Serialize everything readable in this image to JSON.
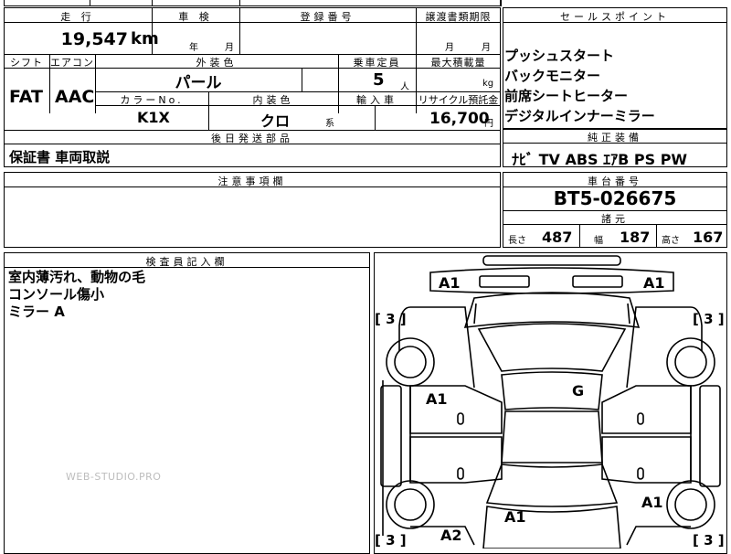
{
  "top_strip": "",
  "labels": {
    "mileage": "走 行",
    "inspection": "車 検",
    "registration": "登録番号",
    "transfer_deadline": "譲渡書類期限",
    "shift": "シフト",
    "aircon": "エアコン",
    "exterior_color": "外装色",
    "capacity": "乗車定員",
    "max_load": "最大積載量",
    "color_no": "カラーNo.",
    "interior_color": "内装色",
    "import": "輸入車",
    "recycle": "リサイクル預託金",
    "later_items": "後日発送部品",
    "notes": "注意事項欄",
    "sales_points": "セールスポイント",
    "equipment": "純正装備",
    "chassis": "車台番号",
    "dimensions": "諸元",
    "inspector": "検査員記入欄"
  },
  "units": {
    "km": "km",
    "year": "年",
    "month": "月",
    "persons": "人",
    "kg": "kg",
    "kei": "系",
    "yen": "円"
  },
  "vehicle": {
    "mileage": "19,547",
    "shift": "FAT",
    "aircon": "AAC",
    "exterior_color": "パール",
    "capacity": "5",
    "color_no": "K1X",
    "interior_color": "クロ",
    "recycle_fee": "16,700"
  },
  "later_items_value": "保証書 車両取説",
  "sales_points": [
    "プッシュスタート",
    "バックモニター",
    "前席シートヒーター",
    "デジタルインナーミラー"
  ],
  "equipment": "ﾅﾋﾞ TV ABS ｴｱB PS PW",
  "chassis_no": "BT5-026675",
  "dims": {
    "length_label": "長さ",
    "length": "487",
    "width_label": "幅",
    "width": "187",
    "height_label": "高さ",
    "height": "167"
  },
  "inspector_notes": [
    "室内薄汚れ、動物の毛",
    "コンソール傷小",
    "ミラー A"
  ],
  "damage_marks": [
    "A1",
    "A1",
    "A1",
    "G",
    "A1",
    "A1",
    "A2"
  ],
  "corner_marks": [
    "[ 3 ]",
    "[ 3 ]",
    "[ 3 ]",
    "[ 3 ]"
  ],
  "watermark": "WEB-STUDIO.PRO"
}
